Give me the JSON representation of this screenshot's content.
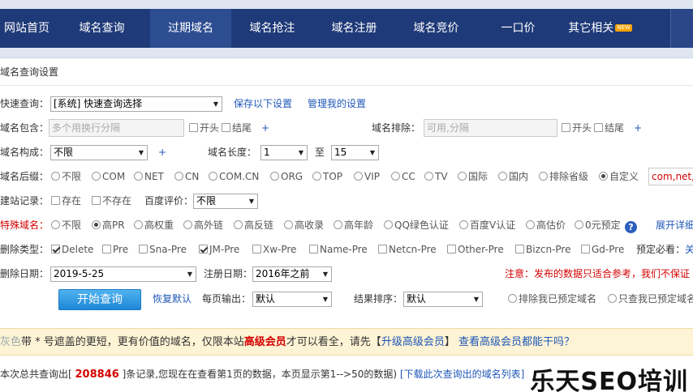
{
  "nav": {
    "items": [
      {
        "label": "网站首页"
      },
      {
        "label": "域名查询"
      },
      {
        "label": "过期域名"
      },
      {
        "label": "域名抢注"
      },
      {
        "label": "域名注册"
      },
      {
        "label": "域名竞价"
      },
      {
        "label": "一口价"
      },
      {
        "label": "其它相关"
      }
    ],
    "new_badge": "NEW",
    "active_index": 2,
    "bar_color": "#1f3a78"
  },
  "panel": {
    "title": "域名查询设置",
    "quick": {
      "label": "快速查询：",
      "select_value": "[系统] 快速查询选择",
      "save_link": "保存以下设置",
      "manage_link": "管理我的设置"
    },
    "contains": {
      "label": "域名包含：",
      "placeholder": "多个用换行分隔",
      "opt_start": "开头",
      "opt_end": "结尾",
      "plus": "+",
      "exclude_label": "域名排除：",
      "exclude_placeholder": "可用,分隔",
      "ex_start": "开头",
      "ex_end": "结尾",
      "ex_plus": "+"
    },
    "compose": {
      "label": "域名构成：",
      "value": "不限",
      "plus": "+",
      "length_label": "域名长度：",
      "len_from": "1",
      "to": "至",
      "len_to": "15"
    },
    "suffix": {
      "label": "域名后缀：",
      "options": [
        "不限",
        "COM",
        "NET",
        "CN",
        "COM.CN",
        "ORG",
        "TOP",
        "VIP",
        "CC",
        "TV",
        "国际",
        "国内",
        "排除省级",
        "自定义"
      ],
      "selected": "自定义",
      "custom_value": "com,net,"
    },
    "site": {
      "label": "建站记录：",
      "exists": "存在",
      "not_exists": "不存在",
      "baidu_label": "百度评价：",
      "baidu_value": "不限"
    },
    "special": {
      "label": "特殊域名：",
      "options": [
        "不限",
        "高PR",
        "高权重",
        "高外链",
        "高反链",
        "高收录",
        "高年龄",
        "QQ绿色认证",
        "百度V认证",
        "高估价",
        "0元预定"
      ],
      "selected": "高PR",
      "help": "?",
      "expand_link": "展开详细"
    },
    "delete_type": {
      "label": "删除类型：",
      "options": [
        "Delete",
        "Pre",
        "Sna-Pre",
        "JM-Pre",
        "Xw-Pre",
        "Name-Pre",
        "Netcn-Pre",
        "Other-Pre",
        "Bizcn-Pre",
        "Gd-Pre"
      ],
      "checked": [
        "Delete",
        "JM-Pre"
      ],
      "reserve_label": "预定必看：",
      "reserve_link": "关"
    },
    "dates": {
      "delete_label": "删除日期：",
      "delete_value": "2019-5-25",
      "reg_label": "注册日期：",
      "reg_value": "2016年之前",
      "note": "注意：发布的数据只适合参考，我们不保证"
    },
    "actions": {
      "query_button": "开始查询",
      "reset_link": "恢复默认",
      "per_page_label": "每页输出：",
      "per_page_value": "默认",
      "sort_label": "结果排序：",
      "sort_value": "默认",
      "exclude_reserved": "排除我已预定域名",
      "only_reserved": "只查我已预定域名"
    }
  },
  "notice": {
    "prefix": "灰色",
    "text1": "带 * 号遮盖的更短，更有价值的域名，仅限本站",
    "vip": "高级会员",
    "text2": "才可以看全，请先【",
    "upgrade_link": "升级高级会员",
    "text3": "】",
    "benefit_link": "查看高级会员都能干吗？"
  },
  "result": {
    "text1": "本次总共查询出[",
    "count": "208846",
    "text2": "]条记录,您现在在查看第1页的数据，本页显示第1-->50的数据)",
    "download_link": "[下载此次查询出的域名列表]"
  },
  "watermark": "乐天SEO培训"
}
